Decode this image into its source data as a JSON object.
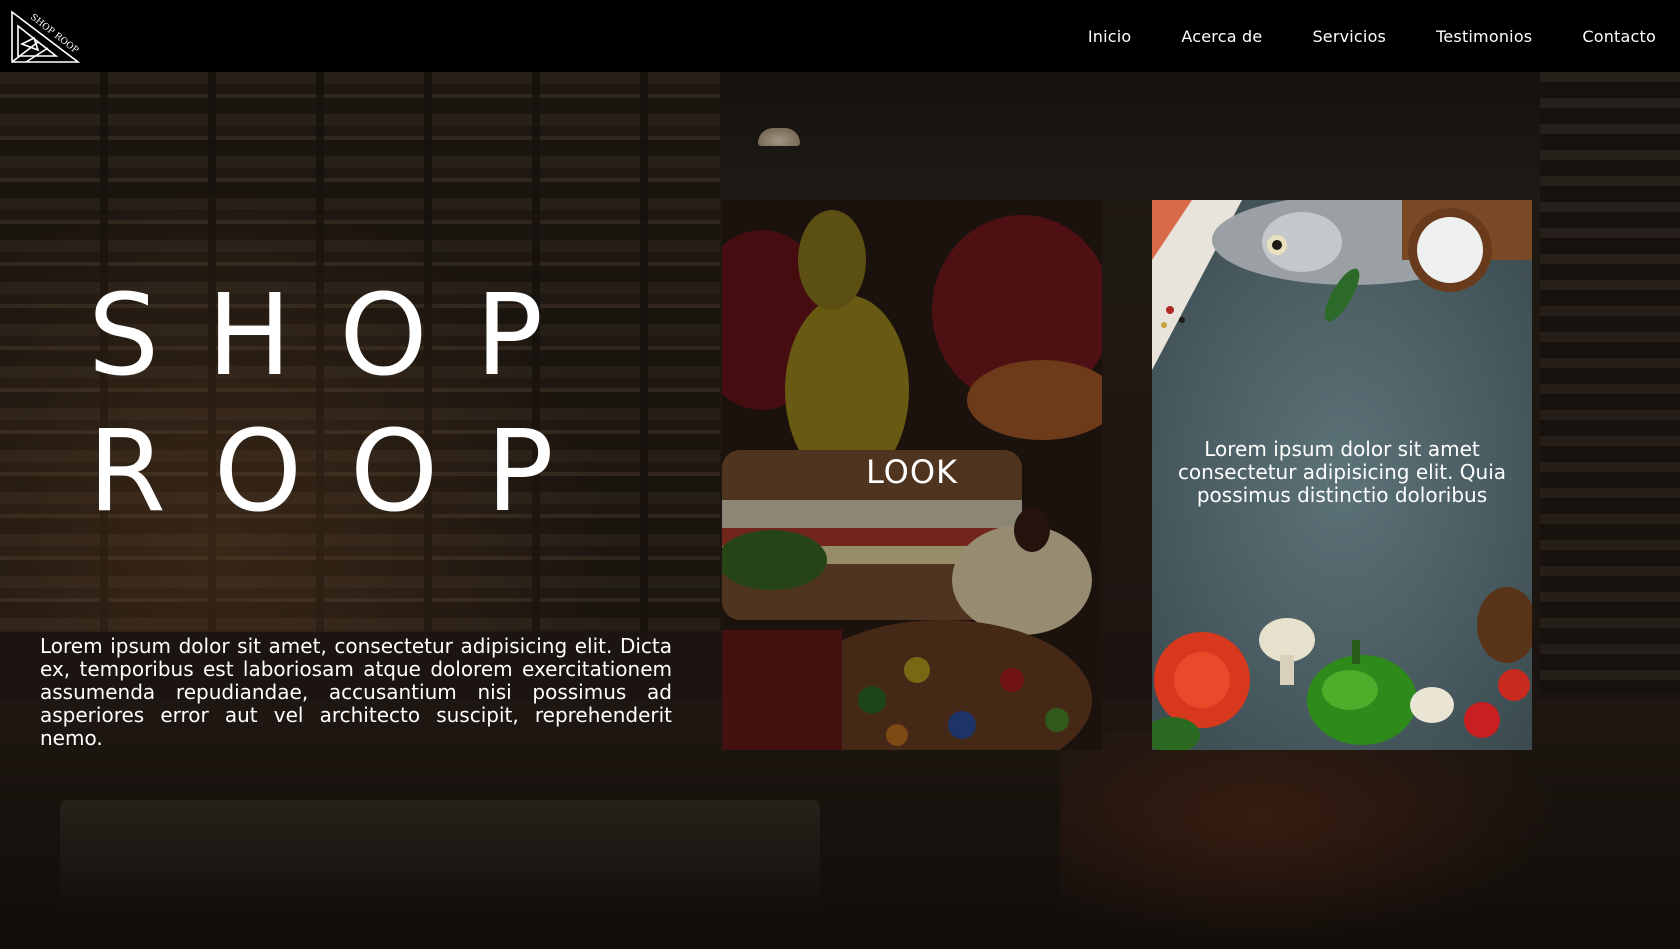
{
  "brand": {
    "logo_text": "SHOP ROOP"
  },
  "nav": {
    "items": [
      {
        "label": "Inicio"
      },
      {
        "label": "Acerca de"
      },
      {
        "label": "Servicios"
      },
      {
        "label": "Testimonios"
      },
      {
        "label": "Contacto"
      }
    ]
  },
  "hero": {
    "title_line1": "SHOP",
    "title_line2": "ROOP",
    "description": "Lorem ipsum dolor sit amet, consectetur adipisicing elit. Dicta ex, temporibus est laboriosam atque dolorem exercitationem assumenda repudiandae, accusantium nisi possimus ad asperiores error aut vel architecto suscipit, reprehenderit nemo."
  },
  "cards": {
    "look_label": "LOOK",
    "blurb": "Lorem ipsum dolor sit amet consectetur adipisicing elit. Quia possimus distinctio doloribus"
  }
}
